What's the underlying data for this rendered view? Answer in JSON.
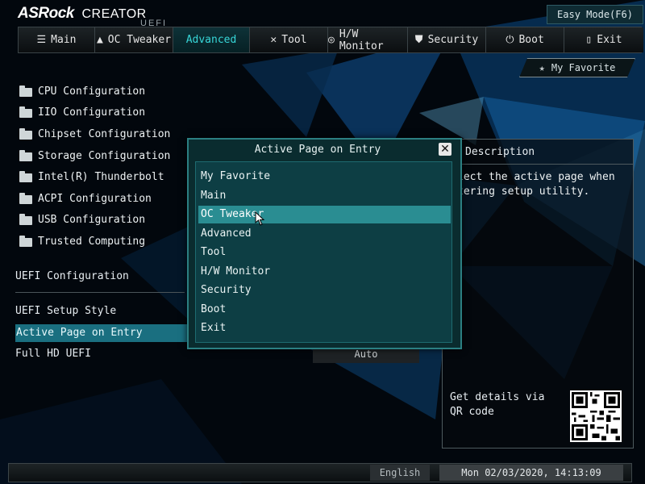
{
  "brand": {
    "name": "ASRock",
    "series": "CREATOR",
    "uefi": "UEFI"
  },
  "easy_mode": "Easy Mode(F6)",
  "tabs": [
    {
      "label": "Main",
      "icon": "list-icon"
    },
    {
      "label": "OC Tweaker",
      "icon": "rocket-icon"
    },
    {
      "label": "Advanced",
      "icon": "",
      "active": true
    },
    {
      "label": "Tool",
      "icon": "wrench-icon"
    },
    {
      "label": "H/W Monitor",
      "icon": "gauge-icon"
    },
    {
      "label": "Security",
      "icon": "shield-icon"
    },
    {
      "label": "Boot",
      "icon": "power-icon"
    },
    {
      "label": "Exit",
      "icon": "exit-door-icon"
    }
  ],
  "favorite": "My Favorite",
  "menu_items": [
    "CPU Configuration",
    "IIO Configuration",
    "Chipset Configuration",
    "Storage Configuration",
    "Intel(R) Thunderbolt",
    "ACPI Configuration",
    "USB Configuration",
    "Trusted Computing"
  ],
  "uefi_section": {
    "title": "UEFI Configuration",
    "settings": [
      {
        "label": "UEFI Setup Style"
      },
      {
        "label": "Active Page on Entry",
        "selected": true
      },
      {
        "label": "Full HD UEFI",
        "value": "Auto"
      }
    ]
  },
  "description": {
    "header": "Description",
    "text": "lect the active page when tering setup utility.",
    "qr_text": "Get details via QR code"
  },
  "dialog": {
    "title": "Active Page on Entry",
    "options": [
      "My Favorite",
      "Main",
      "OC Tweaker",
      "Advanced",
      "Tool",
      "H/W Monitor",
      "Security",
      "Boot",
      "Exit"
    ],
    "highlighted": "OC Tweaker"
  },
  "footer": {
    "language": "English",
    "datetime": "Mon 02/03/2020, 14:13:09"
  },
  "colors": {
    "accent": "#37d6d8",
    "selected_row": "#1a6f80",
    "dialog_bg": "#0a2c2f",
    "highlight": "#2a8d92"
  }
}
